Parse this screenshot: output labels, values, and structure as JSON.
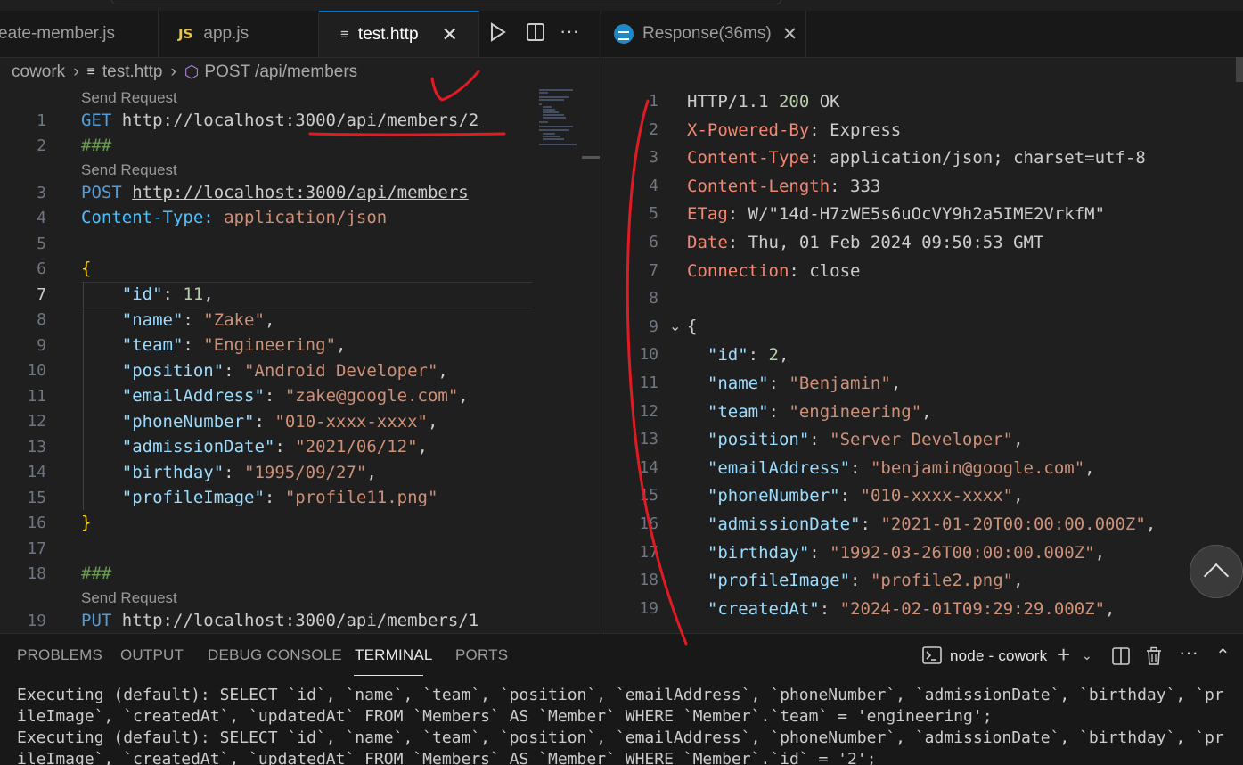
{
  "left_tabs": [
    {
      "label": "eate-member.js",
      "icon": "js-file-icon"
    },
    {
      "label": "app.js",
      "icon": "js-file-icon"
    },
    {
      "label": "test.http",
      "icon": "http-file-icon"
    }
  ],
  "breadcrumb": {
    "folder": "cowork",
    "file": "test.http",
    "symbol": "POST /api/members"
  },
  "codelens": "Send Request",
  "editor": {
    "line_numbers": [
      "1",
      "2",
      "3",
      "4",
      "5",
      "6",
      "7",
      "8",
      "9",
      "10",
      "11",
      "12",
      "13",
      "14",
      "15",
      "16",
      "17",
      "18",
      "19"
    ],
    "l1_method": "GET",
    "l1_url": "http://localhost:3000/api/members/2",
    "l2": "###",
    "l3_method": "POST",
    "l3_url": "http://localhost:3000/api/members",
    "l4_key": "Content-Type:",
    "l4_val": "application/json",
    "l6": "{",
    "json": [
      {
        "k": "\"id\"",
        "v": "11",
        "num": true
      },
      {
        "k": "\"name\"",
        "v": "\"Zake\""
      },
      {
        "k": "\"team\"",
        "v": "\"Engineering\""
      },
      {
        "k": "\"position\"",
        "v": "\"Android Developer\""
      },
      {
        "k": "\"emailAddress\"",
        "v": "\"zake@google.com\""
      },
      {
        "k": "\"phoneNumber\"",
        "v": "\"010-xxxx-xxxx\""
      },
      {
        "k": "\"admissionDate\"",
        "v": "\"2021/06/12\""
      },
      {
        "k": "\"birthday\"",
        "v": "\"1995/09/27\""
      },
      {
        "k": "\"profileImage\"",
        "v": "\"profile11.png\""
      }
    ],
    "l16": "}",
    "l18": "###",
    "l19_method": "PUT",
    "l19_url": "http://localhost:3000/api/members/1"
  },
  "response": {
    "tab_label": "Response(36ms)",
    "status": {
      "proto": "HTTP/1.1 ",
      "code": "200",
      "text": " OK"
    },
    "headers": [
      {
        "k": "X-Powered-By",
        "v": "Express"
      },
      {
        "k": "Content-Type",
        "v": "application/json; charset=utf-8"
      },
      {
        "k": "Content-Length",
        "v": "333"
      },
      {
        "k": "ETag",
        "v": "W/\"14d-H7zWE5s6uOcVY9h2a5IME2VrkfM\""
      },
      {
        "k": "Date",
        "v": "Thu, 01 Feb 2024 09:50:53 GMT"
      },
      {
        "k": "Connection",
        "v": "close"
      }
    ],
    "open_brace": "{",
    "json": [
      {
        "k": "\"id\"",
        "v": "2",
        "num": true
      },
      {
        "k": "\"name\"",
        "v": "\"Benjamin\""
      },
      {
        "k": "\"team\"",
        "v": "\"engineering\""
      },
      {
        "k": "\"position\"",
        "v": "\"Server Developer\""
      },
      {
        "k": "\"emailAddress\"",
        "v": "\"benjamin@google.com\""
      },
      {
        "k": "\"phoneNumber\"",
        "v": "\"010-xxxx-xxxx\""
      },
      {
        "k": "\"admissionDate\"",
        "v": "\"2021-01-20T00:00:00.000Z\""
      },
      {
        "k": "\"birthday\"",
        "v": "\"1992-03-26T00:00:00.000Z\""
      },
      {
        "k": "\"profileImage\"",
        "v": "\"profile2.png\""
      },
      {
        "k": "\"createdAt\"",
        "v": "\"2024-02-01T09:29:29.000Z\""
      }
    ],
    "line_numbers": [
      "1",
      "2",
      "3",
      "4",
      "5",
      "6",
      "7",
      "8",
      "9",
      "10",
      "11",
      "12",
      "13",
      "14",
      "15",
      "16",
      "17",
      "18",
      "19"
    ]
  },
  "panel": {
    "tabs": [
      "PROBLEMS",
      "OUTPUT",
      "DEBUG CONSOLE",
      "TERMINAL",
      "PORTS"
    ],
    "active_tab": "TERMINAL",
    "terminal_name": "node - cowork",
    "lines": [
      "Executing (default): SELECT `id`, `name`, `team`, `position`, `emailAddress`, `phoneNumber`, `admissionDate`, `birthday`, `pr",
      "ileImage`, `createdAt`, `updatedAt` FROM `Members` AS `Member` WHERE `Member`.`team` = 'engineering';",
      "Executing (default): SELECT `id`, `name`, `team`, `position`, `emailAddress`, `phoneNumber`, `admissionDate`, `birthday`, `pr",
      "ileImage`, `createdAt`, `updatedAt` FROM `Members` AS `Member` WHERE `Member`.`id` = '2';"
    ]
  },
  "colors": {
    "accent": "#0078d4",
    "annotation": "#e01b24",
    "background": "#1f1f1f"
  }
}
